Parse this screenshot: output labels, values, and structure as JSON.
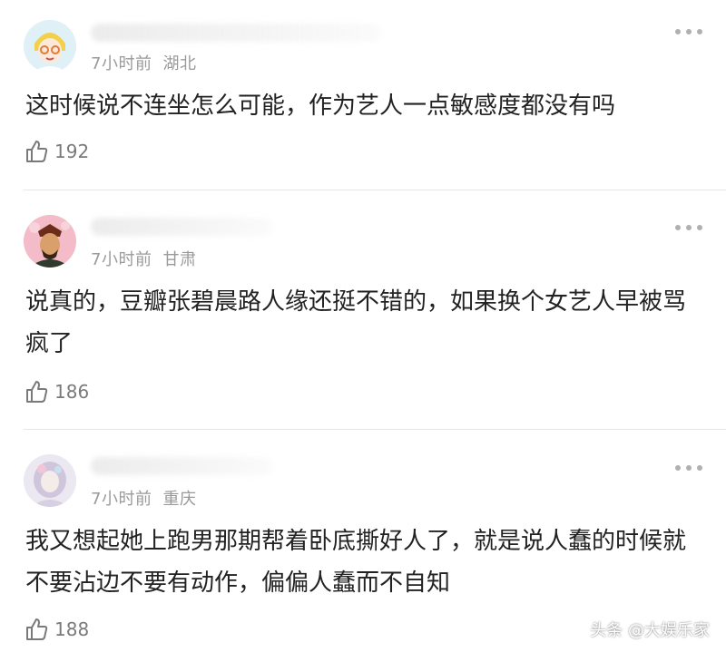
{
  "comments": [
    {
      "time": "7小时前",
      "location": "湖北",
      "text": "这时候说不连坐怎么可能，作为艺人一点敏感度都没有吗",
      "likes": "192"
    },
    {
      "time": "7小时前",
      "location": "甘肃",
      "text": "说真的，豆瓣张碧晨路人缘还挺不错的，如果换个女艺人早被骂疯了",
      "likes": "186"
    },
    {
      "time": "7小时前",
      "location": "重庆",
      "text": "我又想起她上跑男那期帮着卧底撕好人了，就是说人蠢的时候就不要沾边不要有动作，偏偏人蠢而不自知",
      "likes": "188"
    }
  ],
  "watermark": "头条 @大娱乐家",
  "icons": {
    "like": "thumbs-up-icon",
    "more": "more-dots-icon"
  },
  "colors": {
    "text": "#222222",
    "meta": "#9a9a9a",
    "divider": "#e6e6e6"
  }
}
